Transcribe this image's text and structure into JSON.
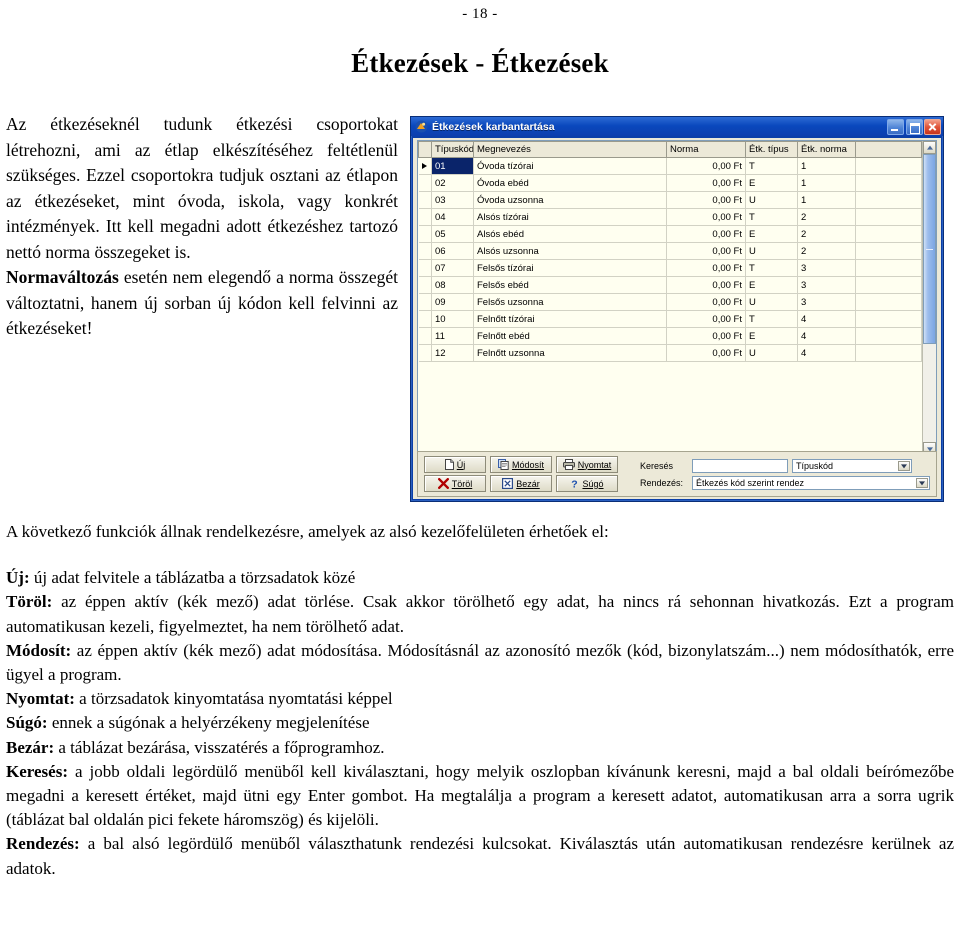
{
  "document": {
    "page_number": "- 18 -",
    "title": "Étkezések - Étkezések",
    "intro": {
      "part1": "Az étkezéseknél tudunk étkezési csoportokat létrehozni, ami az étlap elkészítéséhez feltétlenül szükséges. Ezzel csoportokra tudjuk osztani az étlapon az étkezéseket, mint óvoda, iskola, vagy konkrét intézmények. Itt kell megadni adott étkezéshez tartozó nettó norma összegeket is.",
      "bold2": "Normaváltozás",
      "part2": " esetén nem elegendő a norma összegét változtatni, hanem új sorban új kódon kell felvinni az étkezéseket!"
    },
    "body": {
      "lead": "A következő funkciók állnak rendelkezésre, amelyek az alsó kezelőfelületen érhetőek el:",
      "items": [
        {
          "term": "Új:",
          "desc": " új adat felvitele a táblázatba a törzsadatok közé"
        },
        {
          "term": "Töröl:",
          "desc": " az éppen aktív (kék mező) adat törlése. Csak akkor törölhető egy adat, ha nincs rá sehonnan hivatkozás. Ezt a program automatikusan kezeli, figyelmeztet, ha nem törölhető adat."
        },
        {
          "term": "Módosít:",
          "desc": " az éppen aktív (kék mező) adat módosítása. Módosításnál az azonosító mezők (kód, bizonylatszám...) nem módosíthatók, erre ügyel a program."
        },
        {
          "term": "Nyomtat:",
          "desc": " a törzsadatok kinyomtatása nyomtatási képpel"
        },
        {
          "term": "Súgó:",
          "desc": " ennek a súgónak a helyérzékeny megjelenítése"
        },
        {
          "term": "Bezár:",
          "desc": " a táblázat bezárása, visszatérés a főprogramhoz."
        },
        {
          "term": "Keresés:",
          "desc": " a jobb oldali legördülő menüből kell kiválasztani, hogy melyik oszlopban kívánunk keresni, majd a bal oldali beírómezőbe megadni a keresett értéket, majd ütni egy Enter gombot. Ha megtalálja a program a keresett adatot, automatikusan arra a sorra ugrik (táblázat bal oldalán pici fekete háromszög) és kijelöli."
        },
        {
          "term": "Rendezés:",
          "desc": " a bal alsó legördülő menüből választhatunk rendezési kulcsokat. Kiválasztás után automatikusan rendezésre kerülnek az adatok."
        }
      ]
    }
  },
  "window": {
    "title": "Étkezések karbantartása",
    "controls": {
      "minimize": "–",
      "maximize": "□",
      "close": "✕"
    },
    "grid": {
      "columns": [
        "Típuskód",
        "Megnevezés",
        "Norma",
        "Étk. típus",
        "Étk. norma"
      ],
      "rows": [
        {
          "code": "01",
          "name": "Óvoda tízórai",
          "norma": "0,00 Ft",
          "etip": "T",
          "enorma": "1",
          "selected": true
        },
        {
          "code": "02",
          "name": "Óvoda ebéd",
          "norma": "0,00 Ft",
          "etip": "E",
          "enorma": "1",
          "selected": false
        },
        {
          "code": "03",
          "name": "Óvoda uzsonna",
          "norma": "0,00 Ft",
          "etip": "U",
          "enorma": "1",
          "selected": false
        },
        {
          "code": "04",
          "name": "Alsós tízórai",
          "norma": "0,00 Ft",
          "etip": "T",
          "enorma": "2",
          "selected": false
        },
        {
          "code": "05",
          "name": "Alsós ebéd",
          "norma": "0,00 Ft",
          "etip": "E",
          "enorma": "2",
          "selected": false
        },
        {
          "code": "06",
          "name": "Alsós uzsonna",
          "norma": "0,00 Ft",
          "etip": "U",
          "enorma": "2",
          "selected": false
        },
        {
          "code": "07",
          "name": "Felsős tízórai",
          "norma": "0,00 Ft",
          "etip": "T",
          "enorma": "3",
          "selected": false
        },
        {
          "code": "08",
          "name": "Felsős ebéd",
          "norma": "0,00 Ft",
          "etip": "E",
          "enorma": "3",
          "selected": false
        },
        {
          "code": "09",
          "name": "Felsős uzsonna",
          "norma": "0,00 Ft",
          "etip": "U",
          "enorma": "3",
          "selected": false
        },
        {
          "code": "10",
          "name": "Felnőtt tízórai",
          "norma": "0,00 Ft",
          "etip": "T",
          "enorma": "4",
          "selected": false
        },
        {
          "code": "11",
          "name": "Felnőtt ebéd",
          "norma": "0,00 Ft",
          "etip": "E",
          "enorma": "4",
          "selected": false
        },
        {
          "code": "12",
          "name": "Felnőtt uzsonna",
          "norma": "0,00 Ft",
          "etip": "U",
          "enorma": "4",
          "selected": false
        }
      ]
    },
    "toolbar": {
      "new": "Új",
      "modify": "Módosít",
      "print": "Nyomtat",
      "delete": "Töröl",
      "close": "Bezár",
      "help": "Súgó"
    },
    "search": {
      "label": "Keresés",
      "value": "",
      "placeholder": "",
      "column": "Típuskód"
    },
    "sort": {
      "label": "Rendezés:",
      "value": "Étkezés kód szerint rendez"
    }
  },
  "colors": {
    "titlebar": "#0a48bd",
    "selection": "#0a246a",
    "code_cell": "#ffff00",
    "grid_bg": "#fffff0",
    "dialog_face": "#ece9d8"
  }
}
